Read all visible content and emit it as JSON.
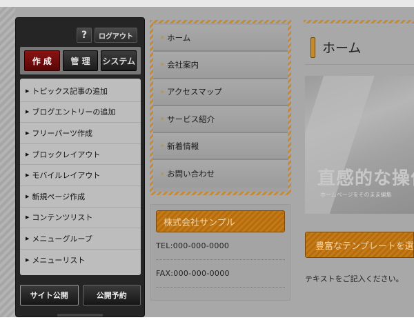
{
  "admin": {
    "help_label": "?",
    "logout_label": "ログアウト",
    "mode_tabs": [
      {
        "label": "作 成",
        "active": true
      },
      {
        "label": "管 理",
        "active": false
      },
      {
        "label": "システム",
        "active": false
      }
    ],
    "menu_items": [
      {
        "label": "トピックス記事の追加"
      },
      {
        "label": "ブログエントリーの追加"
      },
      {
        "label": "フリーパーツ作成"
      },
      {
        "label": "ブロックレイアウト"
      },
      {
        "label": "モバイルレイアウト"
      },
      {
        "label": "新規ページ作成"
      },
      {
        "label": "コンテンツリスト"
      },
      {
        "label": "メニューグループ"
      },
      {
        "label": "メニューリスト"
      }
    ],
    "publish_label": "サイト公開",
    "schedule_label": "公開予約"
  },
  "site_nav": {
    "items": [
      {
        "label": "ホーム"
      },
      {
        "label": "会社案内"
      },
      {
        "label": "アクセスマップ"
      },
      {
        "label": "サービス紹介"
      },
      {
        "label": "新着情報"
      },
      {
        "label": "お問い合わせ"
      }
    ],
    "chevron": "»"
  },
  "company": {
    "name": "株式会社サンプル",
    "tel": "TEL:000-000-0000",
    "fax": "FAX:000-000-0000"
  },
  "main": {
    "heading": "ホーム",
    "hero_text": "直感的な操作",
    "hero_subtext": "ホームページをそのまま編集",
    "template_button": "豊富なテンプレートを選",
    "body_text": "テキストをご記入ください。"
  },
  "colors": {
    "accent_orange": "#c47a17",
    "active_tab": "#8a1313",
    "panel_dark": "#252525"
  }
}
